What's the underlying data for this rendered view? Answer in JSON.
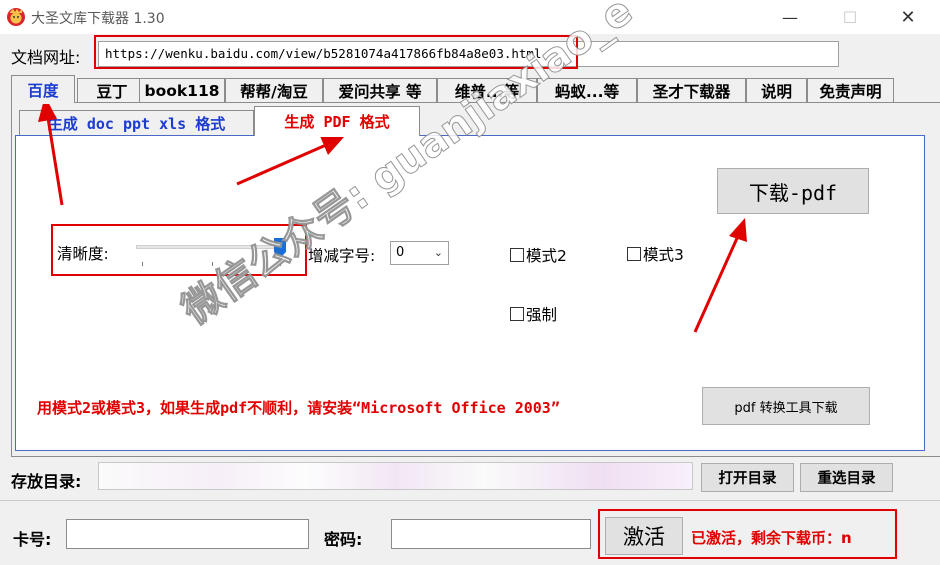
{
  "window": {
    "title": "大圣文库下载器 1.30",
    "icon": "app-logo-icon",
    "controls": {
      "minimize": "—",
      "maximize": "☐",
      "close": "✕"
    }
  },
  "url_row": {
    "label": "文档网址:",
    "value": "https://wenku.baidu.com/view/b5281074a417866fb84a8e03.html"
  },
  "top_tabs": [
    {
      "label": "百度",
      "active": true
    },
    {
      "label": "豆丁",
      "active": false
    },
    {
      "label": "book118",
      "active": false
    },
    {
      "label": "帮帮/淘豆",
      "active": false
    },
    {
      "label": "爱问共享 等",
      "active": false
    },
    {
      "label": "维普...等",
      "active": false
    },
    {
      "label": "蚂蚁...等",
      "active": false
    },
    {
      "label": "圣才下载器",
      "active": false
    },
    {
      "label": "说明",
      "active": false
    },
    {
      "label": "免责声明",
      "active": false
    }
  ],
  "sub_tabs": {
    "doc": "生成 doc ppt xls 格式",
    "pdf": "生成 PDF 格式"
  },
  "pdf_panel": {
    "clarity_label": "清晰度:",
    "clarity_level": 1.0,
    "font_adjust_label": "增减字号:",
    "font_adjust_value": "0",
    "mode2": {
      "label": "模式2",
      "checked": false
    },
    "mode3": {
      "label": "模式3",
      "checked": false
    },
    "force": {
      "label": "强制",
      "checked": false
    },
    "download_button": "下载-pdf",
    "pdf_tool_button": "pdf 转换工具下载",
    "notice": "用模式2或模式3，如果生成pdf不顺利，请安装“Microsoft Office 2003”"
  },
  "storage": {
    "label": "存放目录:",
    "open_button": "打开目录",
    "reselect_button": "重选目录"
  },
  "activation": {
    "card_label": "卡号:",
    "password_label": "密码:",
    "activate_button": "激活",
    "status": "已激活，剩余下载币：n"
  },
  "watermark": "微信公众号: guanjiaxiao_e",
  "colors": {
    "highlight": "#e00000",
    "active_tab_text": "#1a3cd0",
    "panel_border": "#4a68c8"
  }
}
